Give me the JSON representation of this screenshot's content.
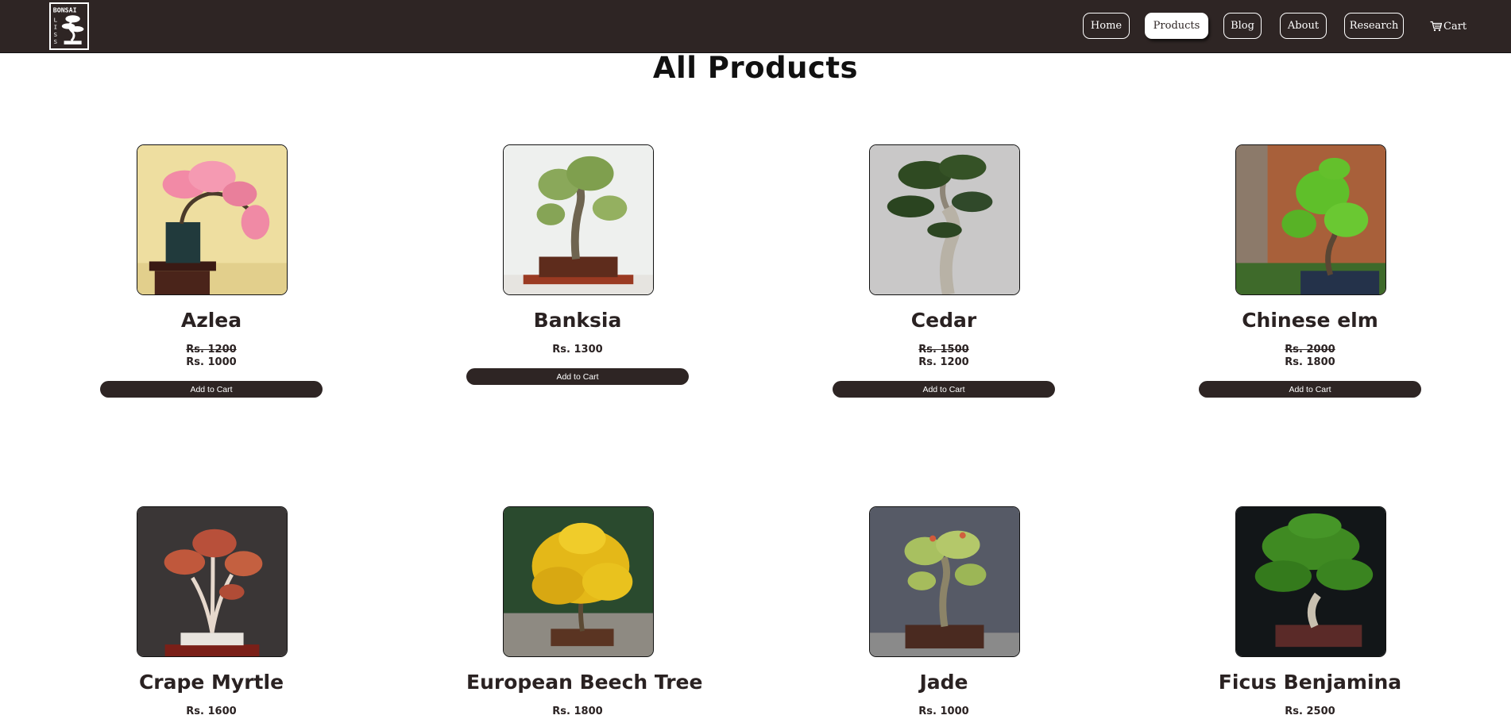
{
  "header": {
    "logo_text": "BONSAI LISS",
    "nav": [
      {
        "label": "Home"
      },
      {
        "label": "Products",
        "active": true
      },
      {
        "label": "Blog"
      },
      {
        "label": "About"
      },
      {
        "label": "Research"
      }
    ],
    "cart_label": "Cart",
    "cart_icon": "cart-icon"
  },
  "page_title": "All Products",
  "products": [
    {
      "name": "Azlea",
      "old_price": "Rs. 1200",
      "price": "Rs. 1000",
      "button": "Add to Cart",
      "image": "azalea-bonsai-photo"
    },
    {
      "name": "Banksia",
      "price": "Rs. 1300",
      "button": "Add to Cart",
      "image": "banksia-bonsai-photo"
    },
    {
      "name": "Cedar",
      "old_price": "Rs. 1500",
      "price": "Rs. 1200",
      "button": "Add to Cart",
      "image": "cedar-bonsai-photo"
    },
    {
      "name": "Chinese elm",
      "old_price": "Rs. 2000",
      "price": "Rs. 1800",
      "button": "Add to Cart",
      "image": "chinese-elm-bonsai-photo"
    },
    {
      "name": "Crape Myrtle",
      "price": "Rs. 1600",
      "image": "crape-myrtle-bonsai-photo"
    },
    {
      "name": "European Beech Tree",
      "price": "Rs. 1800",
      "image": "european-beech-bonsai-photo"
    },
    {
      "name": "Jade",
      "price": "Rs. 1000",
      "image": "jade-bonsai-photo"
    },
    {
      "name": "Ficus Benjamina",
      "price": "Rs. 2500",
      "image": "ficus-benjamina-bonsai-photo"
    }
  ],
  "colors": {
    "header_bg": "#2e2524",
    "button_bg": "#2e2524",
    "text": "#2a2222",
    "page_bg": "#ffffff"
  }
}
